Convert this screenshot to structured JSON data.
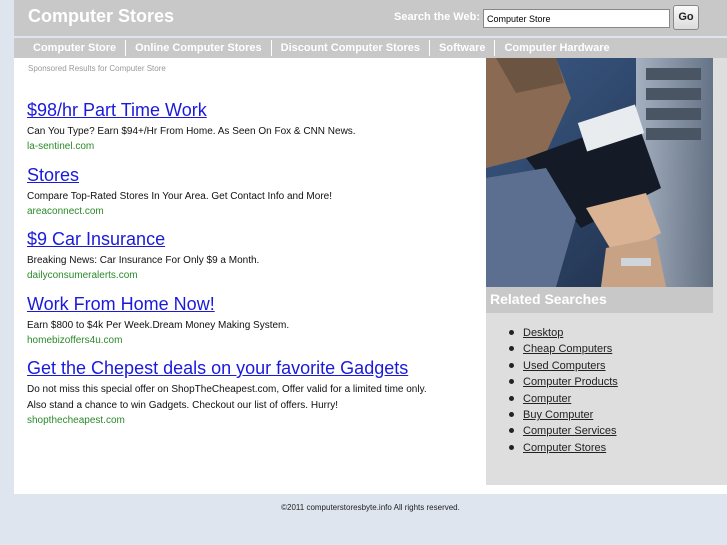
{
  "header": {
    "site_title": "Computer Stores",
    "search_label": "Search the Web:",
    "search_value": "Computer Store",
    "go_label": "Go"
  },
  "nav": {
    "items": [
      {
        "label": "Computer Store"
      },
      {
        "label": "Online Computer Stores"
      },
      {
        "label": "Discount Computer Stores"
      },
      {
        "label": "Software"
      },
      {
        "label": "Computer Hardware"
      }
    ]
  },
  "main": {
    "sponsored": "Sponsored Results for Computer Store",
    "ads": [
      {
        "title": "$98/hr Part Time Work",
        "desc": "Can You Type? Earn $94+/Hr From Home. As Seen On Fox & CNN News.",
        "url": "la-sentinel.com"
      },
      {
        "title": "Stores",
        "desc": "Compare Top-Rated Stores In Your Area. Get Contact Info and More!",
        "url": "areaconnect.com"
      },
      {
        "title": "$9 Car Insurance",
        "desc": "Breaking News: Car Insurance For Only $9 a Month.",
        "url": "dailyconsumeralerts.com"
      },
      {
        "title": "Work From Home Now!",
        "desc": "Earn $800 to $4k Per Week.Dream Money Making System.",
        "url": "homebizoffers4u.com"
      },
      {
        "title": "Get the Chepest deals on your favorite Gadgets",
        "desc": "Do not miss this special offer on ShopTheCheapest.com, Offer valid for a limited time only. Also stand a chance to win Gadgets. Checkout our list of offers. Hurry!",
        "url": "shopthecheapest.com"
      }
    ]
  },
  "sidebar": {
    "related_title": "Related Searches",
    "items": [
      {
        "label": "Desktop"
      },
      {
        "label": "Cheap Computers"
      },
      {
        "label": "Used Computers"
      },
      {
        "label": "Computer Products"
      },
      {
        "label": "Computer"
      },
      {
        "label": "Buy Computer"
      },
      {
        "label": "Computer Services"
      },
      {
        "label": "Computer Stores"
      }
    ]
  },
  "footer": {
    "text": "©2011 computerstoresbyte.info All rights reserved."
  }
}
